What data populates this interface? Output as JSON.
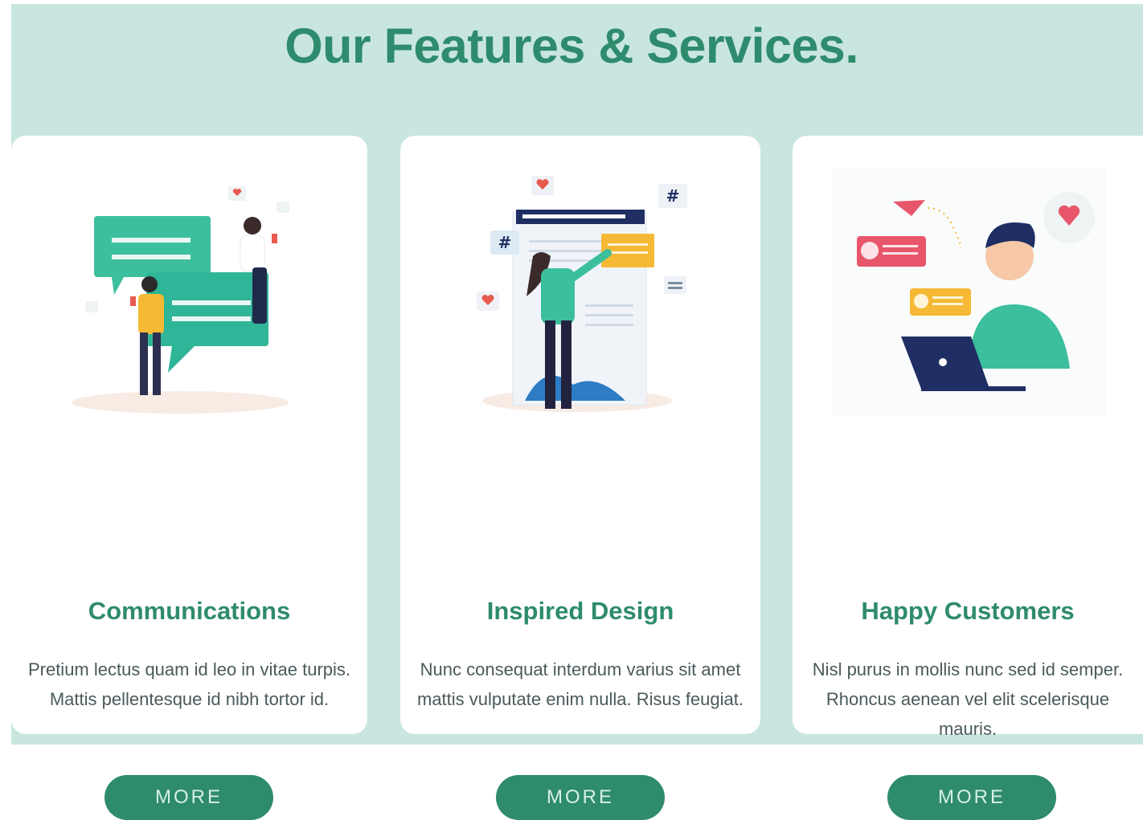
{
  "header": {
    "title": "Our Features & Services."
  },
  "cards": [
    {
      "title": "Communications",
      "description": "Pretium lectus quam id leo in vitae turpis. Mattis pellentesque id nibh tortor id.",
      "button_label": "MORE",
      "illustration": "chat-people-illustration"
    },
    {
      "title": "Inspired Design",
      "description": "Nunc consequat interdum varius sit amet mattis vulputate enim nulla. Risus feugiat.",
      "button_label": "MORE",
      "illustration": "design-board-illustration"
    },
    {
      "title": "Happy Customers",
      "description": "Nisl purus in mollis nunc sed id semper. Rhoncus aenean vel elit scelerisque mauris.",
      "button_label": "MORE",
      "illustration": "customer-laptop-illustration"
    }
  ],
  "colors": {
    "accent": "#2e8b6e",
    "background": "#c8e6df",
    "card": "#ffffff",
    "text": "#4a5a5a"
  }
}
